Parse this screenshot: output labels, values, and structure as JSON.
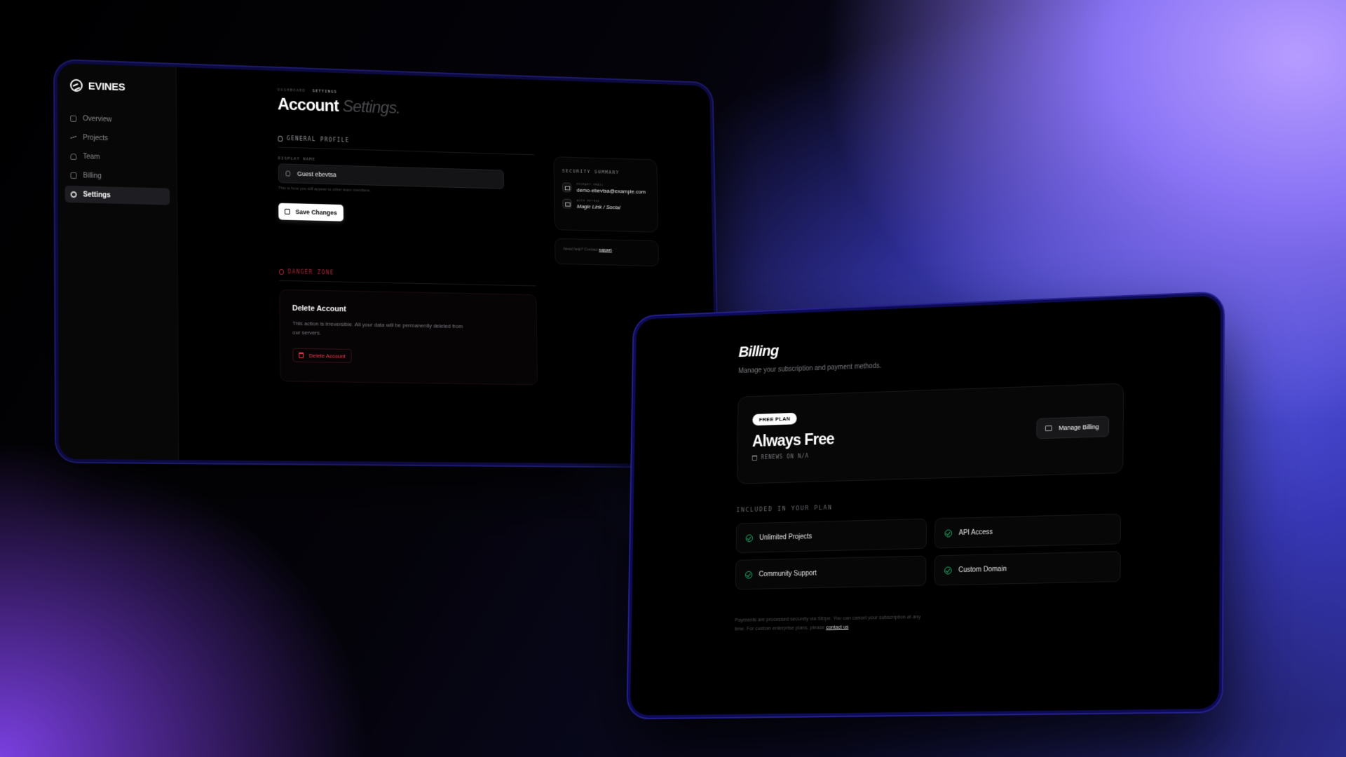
{
  "account_window": {
    "brand": "EVINES",
    "nav": [
      {
        "label": "Overview",
        "icon": "grid-icon"
      },
      {
        "label": "Projects",
        "icon": "bolt-icon"
      },
      {
        "label": "Team",
        "icon": "users-icon"
      },
      {
        "label": "Billing",
        "icon": "credit-card-icon"
      },
      {
        "label": "Settings",
        "icon": "gear-icon",
        "active": true
      }
    ],
    "breadcrumb": {
      "root": "DASHBOARD",
      "current": "SETTINGS"
    },
    "title": {
      "main": "Account",
      "accent": "Settings."
    },
    "general": {
      "section_label": "GENERAL PROFILE",
      "display_name_label": "DISPLAY NAME",
      "display_name_value": "Guest ebevtsa",
      "hint": "This is how you will appear to other team members.",
      "save_label": "Save Changes"
    },
    "danger": {
      "section_label": "DANGER ZONE",
      "title": "Delete Account",
      "description": "This action is irreversible. All your data will be permanently deleted from our servers.",
      "button_label": "Delete Account",
      "color": "#ff3b55"
    },
    "security": {
      "title": "SECURITY SUMMARY",
      "email_key": "PRIMARY EMAIL",
      "email_value": "demo-ebevtsa@example.com",
      "auth_key": "AUTH METHOD",
      "auth_value": "Magic Link / Social"
    },
    "help": {
      "text": "Need help? Contact",
      "link": "support"
    }
  },
  "billing_window": {
    "title": "Billing",
    "subtitle": "Manage your subscription and payment methods.",
    "plan": {
      "badge": "FREE PLAN",
      "name": "Always Free",
      "renews": "RENEWS ON N/A",
      "manage_label": "Manage Billing"
    },
    "included_label": "INCLUDED IN YOUR PLAN",
    "features": [
      "Unlimited Projects",
      "API Access",
      "Community Support",
      "Custom Domain"
    ],
    "check_color": "#1fbf73",
    "footer": {
      "text": "Payments are processed securely via Stripe. You can cancel your subscription at any time. For custom enterprise plans, please",
      "link": "contact us"
    }
  }
}
